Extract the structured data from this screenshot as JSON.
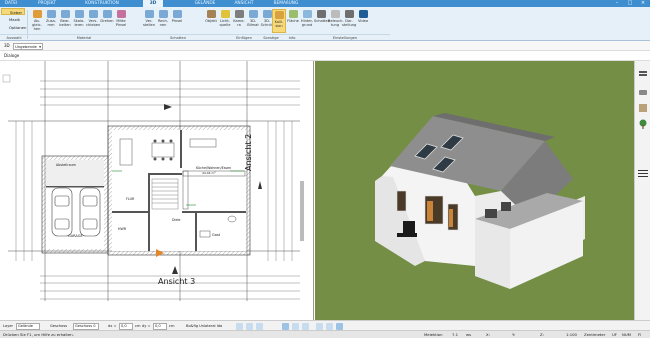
{
  "tabs": [
    "DATEI",
    "PROJEKT",
    "KONSTRUKTION",
    "3D",
    "GELÄNDE",
    "ANSICHT",
    "BEMAßUNG"
  ],
  "active_tab": "3D",
  "side_menu": [
    "Sieber",
    "Maxik",
    "Optionen"
  ],
  "ribbon": {
    "buttons": [
      {
        "label": "Ab­gleic-hen",
        "name": "abgleichen"
      },
      {
        "label": "Zusa-mm",
        "name": "zusammen"
      },
      {
        "label": "Bear-beiten",
        "name": "bearbeiten"
      },
      {
        "label": "Skala-ieren",
        "name": "skalieren"
      },
      {
        "label": "Vers-chieben",
        "name": "verschieben"
      },
      {
        "label": "Drehen",
        "name": "drehen"
      },
      {
        "label": "Mitte Pinsel",
        "name": "mitte-pinsel"
      },
      {
        "label": "Ver-stellen",
        "name": "verstellen"
      },
      {
        "label": "Rech-nen",
        "name": "rechnen"
      },
      {
        "label": "Pinsel",
        "name": "pinsel"
      },
      {
        "label": "Objekt",
        "name": "objekt"
      },
      {
        "label": "Licht-quelle",
        "name": "lichtquelle"
      },
      {
        "label": "Kame-ra",
        "name": "kamera"
      },
      {
        "label": "3D-Bilmat",
        "name": "3d-bilmat"
      },
      {
        "label": "3D-Schnitt",
        "name": "3d-schnitt"
      },
      {
        "label": "Kolli-sion",
        "name": "kollision"
      },
      {
        "label": "Fläche",
        "name": "flaeche"
      },
      {
        "label": "Hinter-grund",
        "name": "hintergrund"
      },
      {
        "label": "Schatten",
        "name": "schatten"
      },
      {
        "label": "Beleuch-tung",
        "name": "beleuchtung"
      },
      {
        "label": "Dar-stellung",
        "name": "darstellung"
      },
      {
        "label": "Video",
        "name": "video"
      }
    ],
    "groups": [
      "Auswahl",
      "Material",
      "Schatten",
      "Einfügen",
      "Sonstige",
      "Info",
      "Einstellungen"
    ]
  },
  "row2": {
    "combo_value": "Ungebende",
    "prefix": "3D"
  },
  "row3": {
    "tab_label": "Dialoge"
  },
  "plan": {
    "labels": {
      "kueche": "Küche/Wohnen/Essen",
      "kueche_area": "44,04 m²",
      "garage": "GARAGE",
      "diele": "Diele",
      "gast": "Gast",
      "hwr": "HWR",
      "flur": "FLUR",
      "ansicht2": "Ansicht 2",
      "ansicht3": "Ansicht 3",
      "abstellraum": "Abstellraum"
    }
  },
  "bottom": {
    "layer_label": "Layer",
    "layer_value": "Gelände",
    "geschoss_label": "Geschoss",
    "geschoss_value": "Geschoss 0",
    "dx_label": "dx =",
    "dx_value": "0,0",
    "cm1": "cm",
    "dy_label": "dy =",
    "dy_value": "0,0",
    "cm2": "cm",
    "dl_label": "dl =",
    "dl_value": "0,0",
    "cm3": "cm",
    "dblc_label": "Bo&fig Unlateral Ida"
  },
  "status": {
    "help": "Drücken Sie F1, um Hilfe zu erhalten.",
    "mode": "Melektion",
    "x": "7.1",
    "unit1": "ws",
    "x2": "X:",
    "y": "Y:",
    "z": "Z:",
    "scale": "1:100",
    "mode2": "Zentimeter",
    "caps": "UF",
    "num": "NUM",
    "scrl": "Fl"
  },
  "colors": {
    "topbar": "#3f8fd0",
    "ribbon": "#e6f0f8",
    "grass": "#748e45"
  }
}
